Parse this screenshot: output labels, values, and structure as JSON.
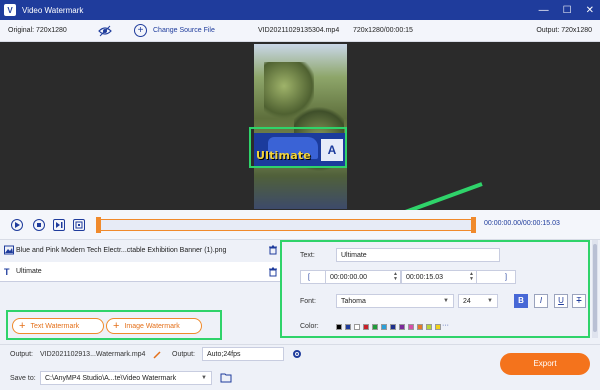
{
  "titlebar": {
    "title": "Video Watermark",
    "logo": "V",
    "min": "—",
    "max": "☐",
    "close": "✕"
  },
  "infobar": {
    "original": "Original: 720x1280",
    "change_source": "Change Source File",
    "filename": "VID20211029135304.mp4",
    "meta": "720x1280/00:00:15",
    "output": "Output: 720x1280"
  },
  "preview": {
    "watermark_text": "Ultimate",
    "banner_logo": "A"
  },
  "playback": {
    "time": "00:00:00.00/00:00:15.03"
  },
  "layers": [
    {
      "label": "Blue and Pink Modern Tech Electr...ctable Exhibition Banner (1).png",
      "icon": "image-icon"
    },
    {
      "label": "Ultimate",
      "icon": "text-icon"
    }
  ],
  "buttons": {
    "text_watermark": "Text Watermark",
    "image_watermark": "Image Watermark",
    "plus": "+"
  },
  "editor": {
    "text_label": "Text:",
    "text_value": "Ultimate",
    "start_time": "00:00:00.00",
    "end_time": "00:00:15.03",
    "font_label": "Font:",
    "font_value": "Tahoma",
    "size_value": "24",
    "color_label": "Color:",
    "more_colors": "···",
    "bracket_left": "[",
    "bracket_right": "]",
    "bold": "B",
    "italic": "I",
    "underline": "U",
    "strike": "T",
    "colors": [
      "#000000",
      "#1f3c9c",
      "#ffffff",
      "#c8202a",
      "#1f9b3a",
      "#2b9fd8",
      "#1c2f8c",
      "#7a2a9a",
      "#d64fa8",
      "#e47a2a",
      "#b7d63a",
      "#f2d21a"
    ]
  },
  "bottom": {
    "output_label": "Output:",
    "output_file": "VID2021102913...Watermark.mp4",
    "output2_label": "Output:",
    "output_format": "Auto;24fps",
    "save_label": "Save to:",
    "save_path": "C:\\AnyMP4 Studio\\A...te\\Video Watermark",
    "export": "Export"
  },
  "colors": {
    "brand": "#1f3c9c",
    "accent": "#f4731c",
    "highlight": "#2fd36a"
  }
}
